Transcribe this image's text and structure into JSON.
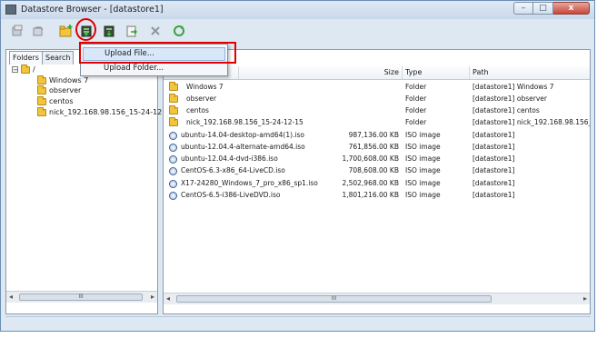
{
  "window": {
    "title": "Datastore Browser - [datastore1]",
    "controls": {
      "minimize": "–",
      "maximize": "□",
      "close": "x"
    }
  },
  "toolbar": {
    "icons": [
      "search-datastore-icon",
      "refresh-left-icon",
      "new-folder-icon",
      "upload-icon",
      "download-icon",
      "move-icon",
      "delete-icon",
      "refresh-icon"
    ]
  },
  "upload_menu": {
    "items": [
      {
        "label": "Upload File..."
      },
      {
        "label": "Upload Folder..."
      }
    ]
  },
  "left_panel": {
    "tabs": [
      "Folders",
      "Search"
    ],
    "root": "/",
    "expander": "−",
    "tree": [
      "Windows 7",
      "observer",
      "centos",
      "nick_192.168.98.156_15-24-12"
    ],
    "scroll_thumb": "III"
  },
  "right_panel": {
    "columns": {
      "name": "",
      "size": "Size",
      "type": "Type",
      "path": "Path"
    },
    "rows": [
      {
        "name": "Windows 7",
        "size": "",
        "type": "Folder",
        "path": "[datastore1] Windows 7",
        "icon": "folder"
      },
      {
        "name": "observer",
        "size": "",
        "type": "Folder",
        "path": "[datastore1] observer",
        "icon": "folder"
      },
      {
        "name": "centos",
        "size": "",
        "type": "Folder",
        "path": "[datastore1] centos",
        "icon": "folder"
      },
      {
        "name": "nick_192.168.98.156_15-24-12-15",
        "size": "",
        "type": "Folder",
        "path": "[datastore1] nick_192.168.98.156_",
        "icon": "folder"
      },
      {
        "name": "ubuntu-14.04-desktop-amd64(1).iso",
        "size": "987,136.00 KB",
        "type": "ISO image",
        "path": "[datastore1]",
        "icon": "iso"
      },
      {
        "name": "ubuntu-12.04.4-alternate-amd64.iso",
        "size": "761,856.00 KB",
        "type": "ISO image",
        "path": "[datastore1]",
        "icon": "iso"
      },
      {
        "name": "ubuntu-12.04.4-dvd-i386.iso",
        "size": "1,700,608.00 KB",
        "type": "ISO image",
        "path": "[datastore1]",
        "icon": "iso"
      },
      {
        "name": "CentOS-6.3-x86_64-LiveCD.iso",
        "size": "708,608.00 KB",
        "type": "ISO image",
        "path": "[datastore1]",
        "icon": "iso"
      },
      {
        "name": "X17-24280_Windows_7_pro_x86_sp1.iso",
        "size": "2,502,968.00 KB",
        "type": "ISO image",
        "path": "[datastore1]",
        "icon": "iso"
      },
      {
        "name": "CentOS-6.5-i386-LiveDVD.iso",
        "size": "1,801,216.00 KB",
        "type": "ISO image",
        "path": "[datastore1]",
        "icon": "iso"
      }
    ],
    "scroll_thumb": "III"
  },
  "colors": {
    "highlight": "#e00000",
    "folder": "#f2c53d",
    "menu_active": "#d9e8f8"
  }
}
